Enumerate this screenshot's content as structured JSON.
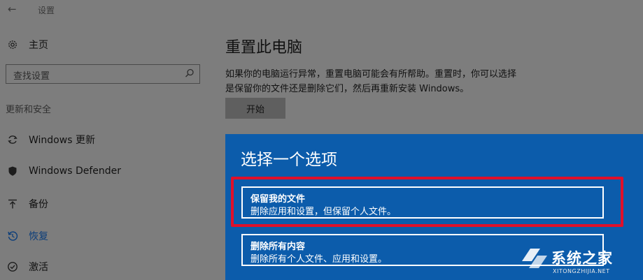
{
  "titlebar": {
    "back_glyph": "←",
    "title": "设置"
  },
  "sidebar": {
    "home_label": "主页",
    "search_placeholder": "查找设置",
    "section_title": "更新和安全",
    "items": [
      {
        "label": "Windows 更新",
        "icon": "sync-icon"
      },
      {
        "label": "Windows Defender",
        "icon": "shield-icon"
      },
      {
        "label": "备份",
        "icon": "backup-icon"
      },
      {
        "label": "恢复",
        "icon": "recovery-icon",
        "active": true
      },
      {
        "label": "激活",
        "icon": "check-circle-icon"
      }
    ]
  },
  "main": {
    "heading": "重置此电脑",
    "description": "如果你的电脑运行异常，重置电脑可能会有所帮助。重置时，你可以选择是保留你的文件还是删除它们，然后再重新安装 Windows。",
    "start_button": "开始"
  },
  "dialog": {
    "title": "选择一个选项",
    "options": [
      {
        "title": "保留我的文件",
        "desc": "删除应用和设置，但保留个人文件。"
      },
      {
        "title": "删除所有内容",
        "desc": "删除所有个人文件、应用和设置。"
      }
    ]
  },
  "watermark": {
    "text": "系统之家",
    "sub": "XITONGZHIJIA.NET"
  },
  "colors": {
    "dialog_bg": "#0c5cab",
    "highlight": "#e0102a",
    "page_bg": "#7d7d7d",
    "active": "#0b3d7a"
  }
}
